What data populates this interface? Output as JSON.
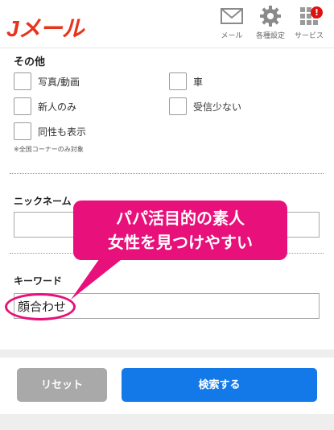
{
  "header": {
    "logo": "Jメール",
    "nav": [
      {
        "label": "メール",
        "icon": "mail-icon"
      },
      {
        "label": "各種設定",
        "icon": "gear-icon"
      },
      {
        "label": "サービス",
        "icon": "grid-icon",
        "badge": "!"
      }
    ]
  },
  "other_section": {
    "title": "その他",
    "options": [
      {
        "label": "写真/動画",
        "checked": false
      },
      {
        "label": "車",
        "checked": false
      },
      {
        "label": "新人のみ",
        "checked": false
      },
      {
        "label": "受信少ない",
        "checked": false
      },
      {
        "label": "同性も表示",
        "checked": false
      }
    ],
    "note": "※全国コーナーのみ対象"
  },
  "nickname": {
    "label": "ニックネーム",
    "value": ""
  },
  "keyword": {
    "label": "キーワード",
    "value": "顔合わせ"
  },
  "callout": {
    "line1": "パパ活目的の素人",
    "line2": "女性を見つけやすい"
  },
  "buttons": {
    "reset": "リセット",
    "search": "検索する"
  },
  "colors": {
    "brand": "#e8341c",
    "accent": "#e8107a",
    "primary": "#1479e8",
    "reset": "#a9a9a9"
  }
}
